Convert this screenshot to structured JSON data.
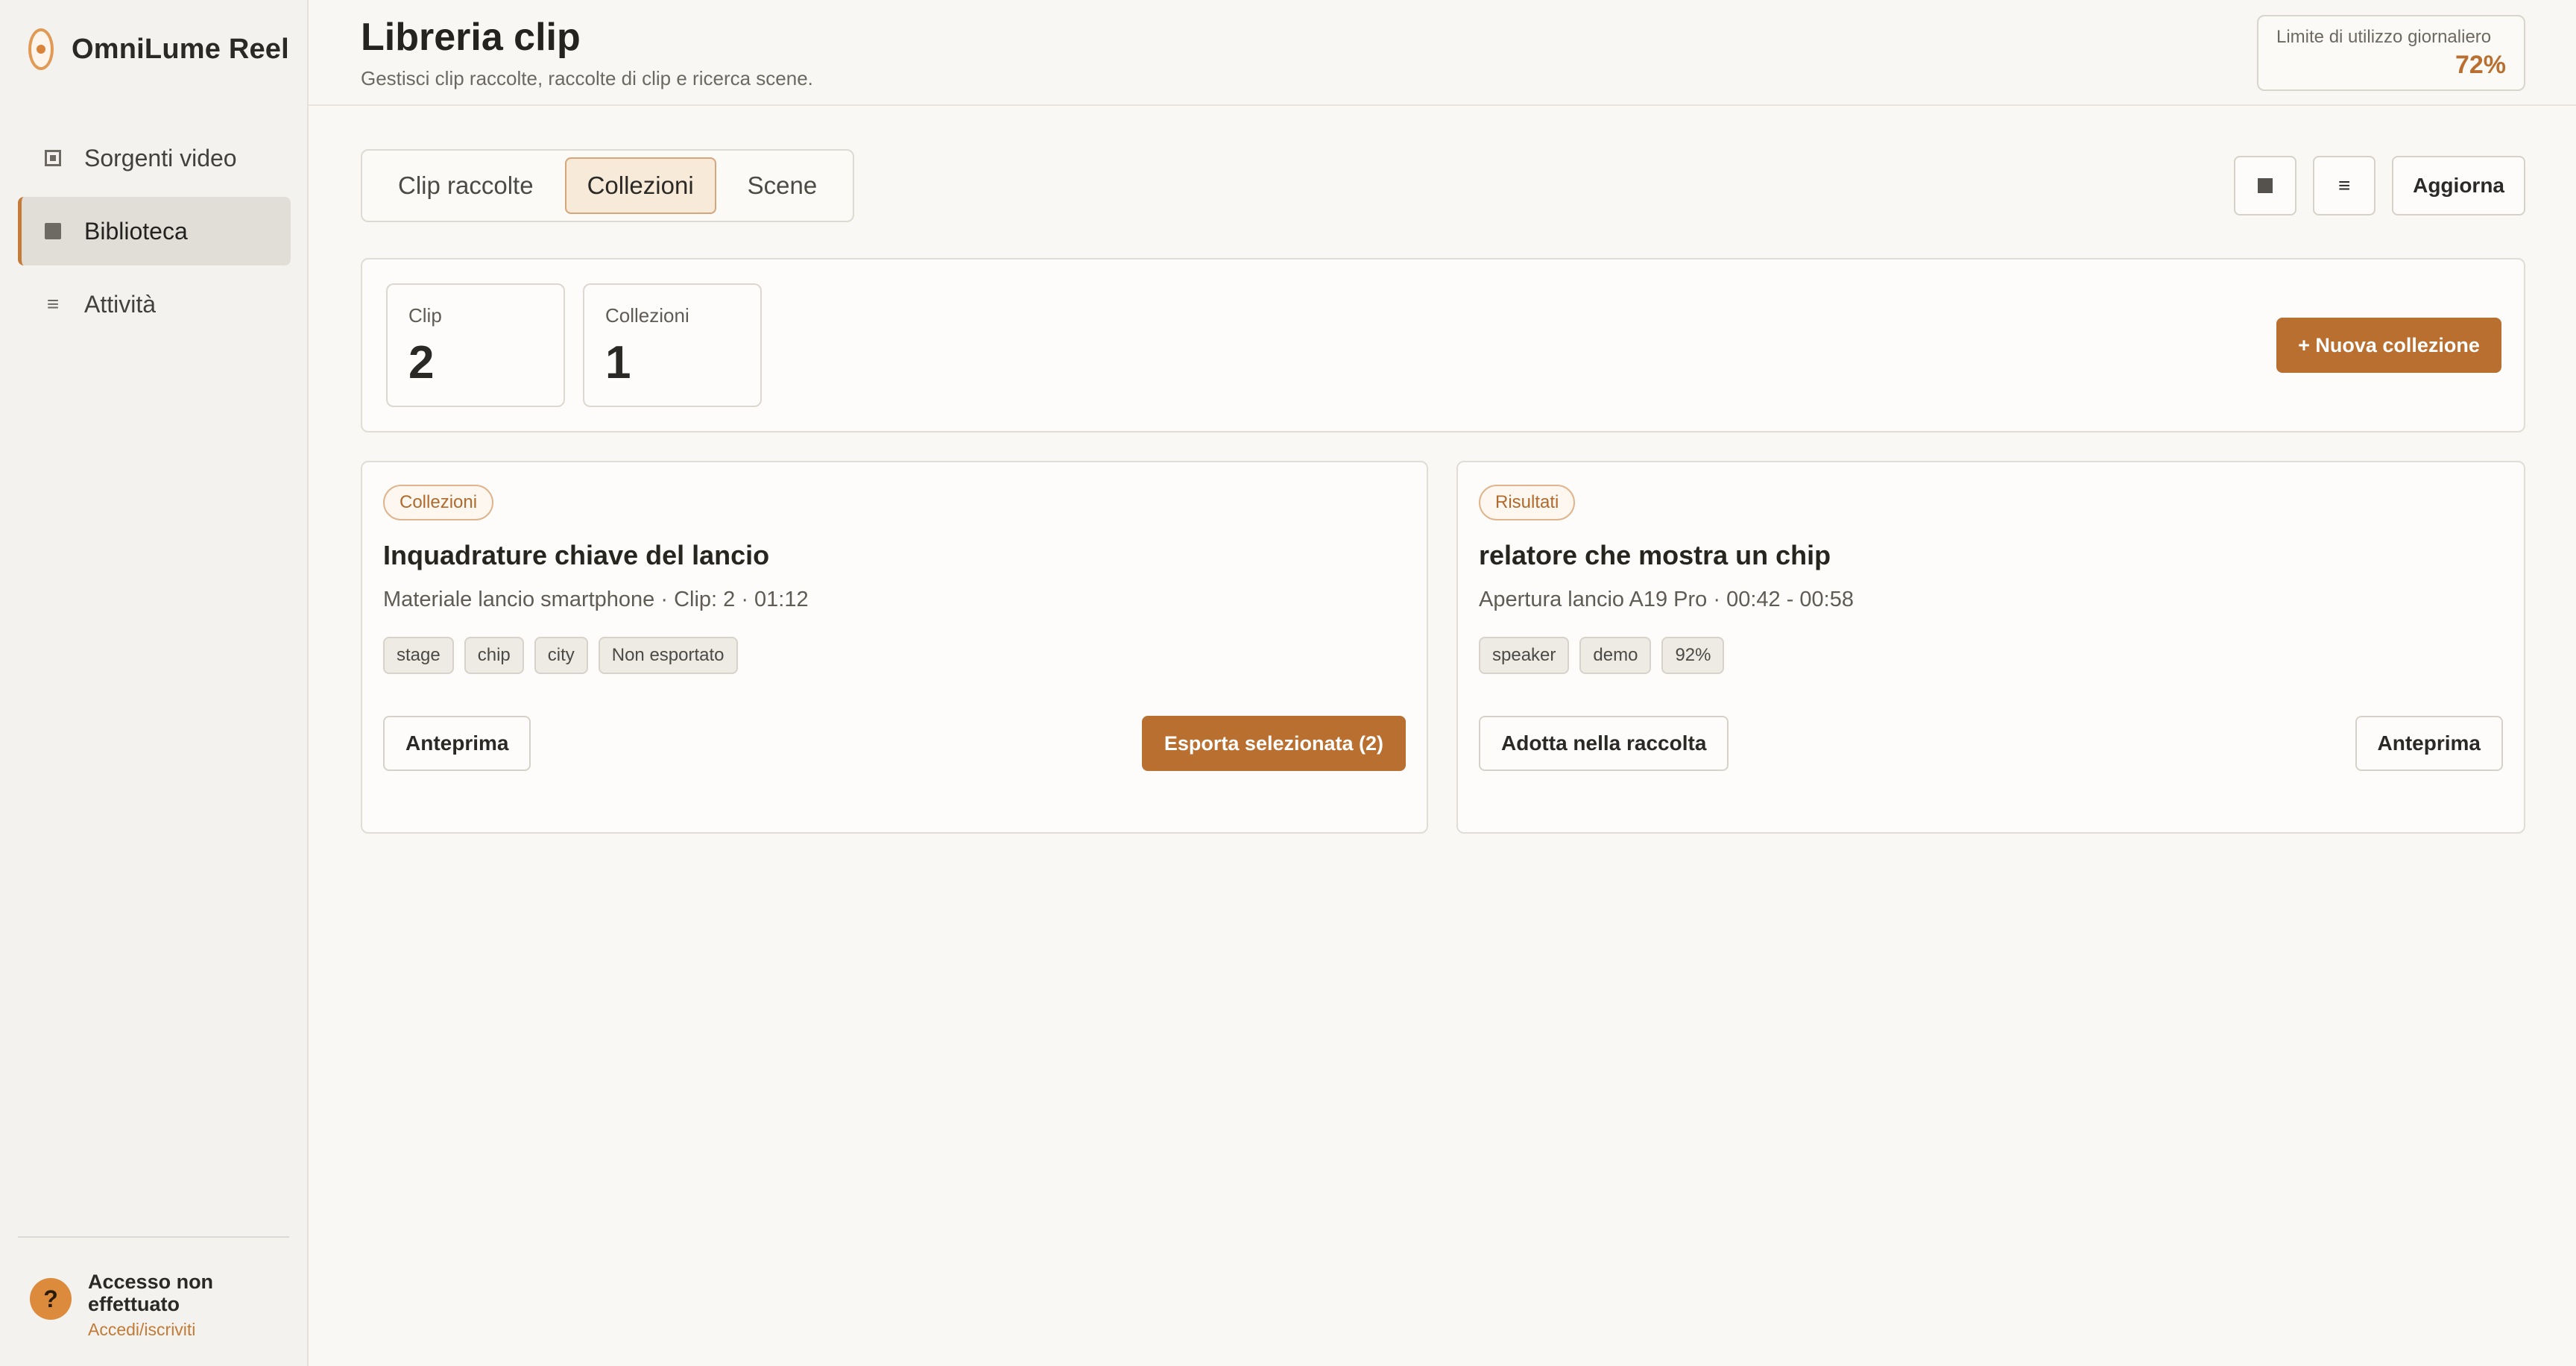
{
  "app": {
    "name": "OmniLume Reel"
  },
  "sidebar": {
    "items": [
      {
        "label": "Sorgenti video",
        "icon": "video-source-icon"
      },
      {
        "label": "Biblioteca",
        "icon": "library-icon"
      },
      {
        "label": "Attività",
        "icon": "list-icon"
      }
    ],
    "account": {
      "avatar": "?",
      "title": "Accesso non effettuato",
      "link": "Accedi/iscriviti"
    }
  },
  "header": {
    "title": "Libreria clip",
    "subtitle": "Gestisci clip raccolte, raccolte di clip e ricerca scene.",
    "usage": {
      "label": "Limite di utilizzo giornaliero",
      "value": "72%"
    }
  },
  "tabs": [
    {
      "label": "Clip raccolte"
    },
    {
      "label": "Collezioni"
    },
    {
      "label": "Scene"
    }
  ],
  "toolbar": {
    "grid_icon": "grid-view-icon",
    "list_icon": "≡",
    "refresh_label": "Aggiorna"
  },
  "stats": [
    {
      "label": "Clip",
      "value": "2"
    },
    {
      "label": "Collezioni",
      "value": "1"
    }
  ],
  "new_collection_label": "+ Nuova collezione",
  "cards": [
    {
      "badge": "Collezioni",
      "title": "Inquadrature chiave del lancio",
      "meta": "Materiale lancio smartphone · Clip: 2 · 01:12",
      "tags": [
        "stage",
        "chip",
        "city",
        "Non esportato"
      ],
      "left_action": "Anteprima",
      "right_action": "Esporta selezionata (2)"
    },
    {
      "badge": "Risultati",
      "title": "relatore che mostra un chip",
      "meta": "Apertura lancio A19 Pro · 00:42 - 00:58",
      "tags": [
        "speaker",
        "demo",
        "92%"
      ],
      "left_action": "Adotta nella raccolta",
      "right_action": "Anteprima"
    }
  ],
  "colors": {
    "accent": "#b96f30",
    "active_tab_bg": "#f8ead9"
  }
}
